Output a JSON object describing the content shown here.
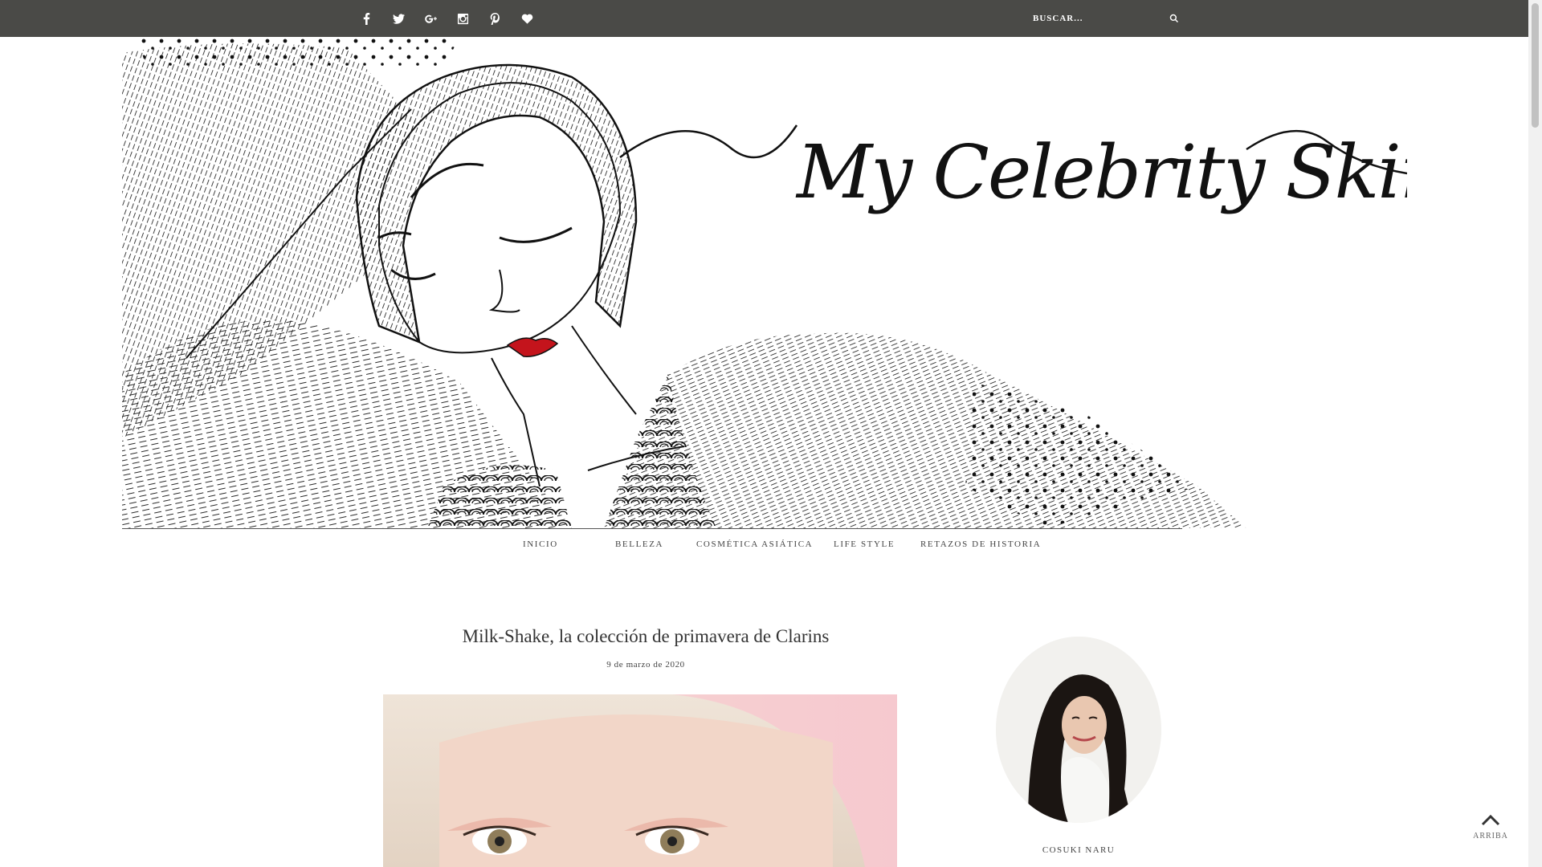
{
  "topbar": {
    "social_icons": [
      "facebook-icon",
      "twitter-icon",
      "google-plus-icon",
      "instagram-icon",
      "pinterest-icon",
      "heart-icon"
    ],
    "search_placeholder": "BUSCAR..."
  },
  "header": {
    "logo_text": "My Celebrity Skin"
  },
  "nav": {
    "items": [
      "INICIO",
      "BELLEZA",
      "COSMÉTICA ASIÁTICA",
      "LIFE STYLE",
      "RETAZOS DE HISTORIA"
    ]
  },
  "post": {
    "title": "Milk-Shake, la colección de primavera de Clarins",
    "date": "9 de marzo de 2020"
  },
  "sidebar": {
    "author_name": "COSUKI NARU"
  },
  "back_to_top": {
    "label": "ARRIBA"
  },
  "colors": {
    "topbar": "#4a4a47",
    "lip_red": "#c4141c"
  }
}
